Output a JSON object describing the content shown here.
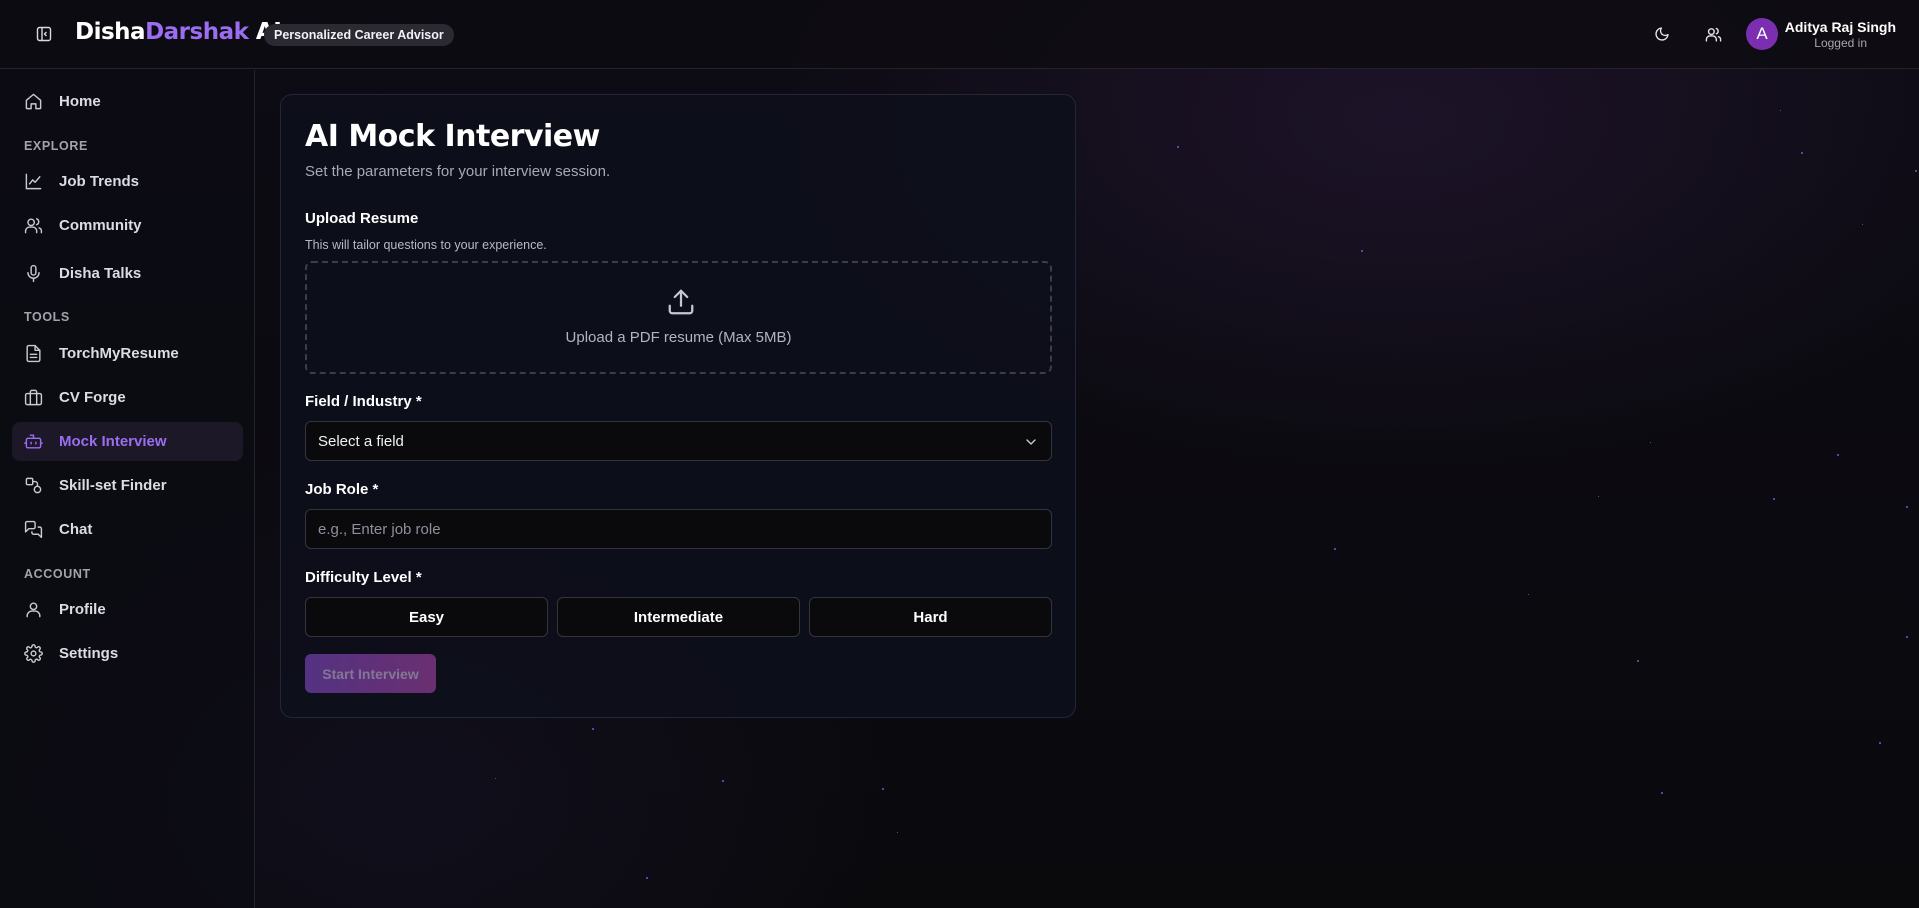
{
  "header": {
    "brand_part1": "Disha",
    "brand_part2": "Darshak",
    "brand_part3": " AI",
    "tagline": "Personalized Career Advisor",
    "sidebar_toggle_icon": "sidebar-collapse-icon",
    "theme_icon": "moon-icon",
    "users_icon": "users-icon",
    "user": {
      "initial": "A",
      "name": "Aditya Raj Singh",
      "status": "Logged in"
    }
  },
  "sidebar": {
    "home": {
      "label": "Home",
      "icon": "home-icon"
    },
    "sections": {
      "explore": "EXPLORE",
      "tools": "TOOLS",
      "account": "ACCOUNT"
    },
    "explore_items": [
      {
        "label": "Job Trends",
        "icon": "line-chart-icon"
      },
      {
        "label": "Community",
        "icon": "users-icon"
      },
      {
        "label": "Disha Talks",
        "icon": "microphone-icon"
      }
    ],
    "tools_items": [
      {
        "label": "TorchMyResume",
        "icon": "document-icon"
      },
      {
        "label": "CV Forge",
        "icon": "briefcase-icon"
      },
      {
        "label": "Mock Interview",
        "icon": "bot-icon",
        "active": true
      },
      {
        "label": "Skill-set Finder",
        "icon": "skill-icon"
      },
      {
        "label": "Chat",
        "icon": "chat-icon"
      }
    ],
    "account_items": [
      {
        "label": "Profile",
        "icon": "user-icon"
      },
      {
        "label": "Settings",
        "icon": "gear-icon"
      }
    ]
  },
  "form": {
    "title": "AI Mock Interview",
    "subtitle": "Set the parameters for your interview session.",
    "upload_label": "Upload Resume",
    "upload_hint": "This will tailor questions to your experience.",
    "upload_text": "Upload a PDF resume (Max 5MB)",
    "field_label": "Field / Industry *",
    "field_value": "Select a field",
    "role_label": "Job Role *",
    "role_placeholder": "e.g., Enter job role",
    "role_value": "",
    "difficulty_label": "Difficulty Level *",
    "difficulty_options": [
      "Easy",
      "Intermediate",
      "Hard"
    ],
    "start_label": "Start Interview"
  },
  "colors": {
    "accent": "#9b6df0",
    "background": "#0b0a10",
    "avatar": "#7b2fb0"
  }
}
